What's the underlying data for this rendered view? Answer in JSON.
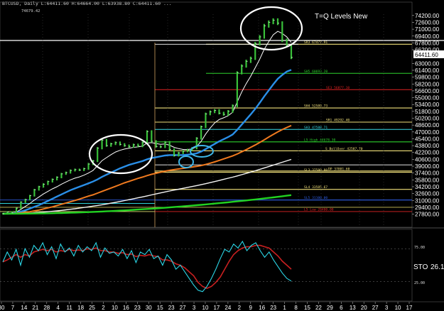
{
  "header": {
    "line": "BTCUSD, Daily  L:64411.60  H:64664.00  L:63938.80  C:64411.60  ...",
    "sub": "74679.42"
  },
  "title_overlay": "T=Q Levels New",
  "last_price": "64411.60",
  "colors": {
    "price": "#39c13a",
    "price_high": "#ffffff",
    "ema_fast": "#ffffff",
    "ema_mid": "#2a8fe8",
    "ema_slow": "#f07a1f",
    "ema_200": "#f5f5f5",
    "ema_long": "#22d322",
    "level_yellow": "#f1e07a",
    "level_green": "#2dd12d",
    "level_red": "#e02323",
    "level_cyan": "#39d9e6",
    "level_blue": "#2f5fe6",
    "stoch_k": "#2bd6e6",
    "stoch_d": "#c82020",
    "annot": "#ffffff",
    "annot_small": "#3fb7e8"
  },
  "chart_data": {
    "type": "line",
    "price_axis": {
      "ticks": [
        "74200.00",
        "72600.00",
        "71000.00",
        "69400.00",
        "67800.00",
        "66200.00",
        "64411.60",
        "63000.00",
        "61400.00",
        "59800.00",
        "58200.00",
        "56600.00",
        "55000.00",
        "53400.00",
        "51800.00",
        "50200.00",
        "48600.00",
        "47000.00",
        "45400.00",
        "43800.00",
        "42200.00",
        "40600.00",
        "39000.00",
        "37400.00",
        "35800.00",
        "34200.00",
        "32600.00",
        "31000.00",
        "29400.00",
        "27800.00"
      ],
      "ylim": [
        26400,
        75000
      ]
    },
    "date_axis": [
      "30",
      "7",
      "14",
      "21",
      "28",
      "4",
      "11",
      "18",
      "25",
      "2",
      "10",
      "16",
      "23",
      "30",
      "15",
      "23",
      "27",
      "3",
      "10",
      "17",
      "24",
      "2",
      "9",
      "16",
      "23",
      "1",
      "8",
      "15",
      "22",
      "29",
      "6",
      "13",
      "20",
      "27",
      "3",
      "10",
      "17"
    ],
    "levels": [
      {
        "label": "SR3 67477.91",
        "value": 67478,
        "color": "yellow"
      },
      {
        "label": "SH5 60693.20",
        "value": 60693,
        "color": "green"
      },
      {
        "label": "SE3 56877.10",
        "value": 56877,
        "color": "red"
      },
      {
        "label": "SH4 52589.73",
        "value": 52590,
        "color": "yellow"
      },
      {
        "label": "SR1 49292.40",
        "value": 49292,
        "color": "yellow"
      },
      {
        "label": "SH3 47588.71",
        "value": 47589,
        "color": "cyan"
      },
      {
        "label": "L5 High 44678.30",
        "value": 44678,
        "color": "green"
      },
      {
        "label": "S BollOver 42587.70",
        "value": 42588,
        "color": "yellow"
      },
      {
        "label": "SL3 37580.80",
        "value": 37581,
        "color": "yellow"
      },
      {
        "label": "DP 37881.60",
        "value": 37882,
        "color": "yellow"
      },
      {
        "label": "SL4 33585.67",
        "value": 33586,
        "color": "yellow"
      },
      {
        "label": "SL5 31100.00",
        "value": 31100,
        "color": "blue"
      },
      {
        "label": "L5 Low 28400.00",
        "value": 28400,
        "color": "red"
      }
    ],
    "series": [
      {
        "values": [
          27900,
          28300,
          28100,
          29200,
          30600,
          31200,
          32100,
          33500,
          34200,
          34800,
          35400,
          35900,
          36400,
          37200,
          37500,
          38000,
          38200,
          38100,
          38400,
          39500,
          40200,
          43200,
          45100,
          43800,
          44200,
          44500,
          44100,
          43800,
          43600,
          44000,
          43700,
          44500,
          47100,
          44800,
          43600,
          43500,
          44600,
          42900,
          41500,
          42100,
          42500,
          42800,
          43200,
          45500,
          48200,
          51200,
          51700,
          52000,
          51400,
          51100,
          51800,
          53100,
          60800,
          62400,
          63500,
          64200,
          67600,
          69200,
          71800,
          72600,
          73100,
          72400,
          68400,
          67200,
          64400
        ]
      },
      {
        "values": [
          27900,
          28000,
          28000,
          28300,
          28900,
          29600,
          30300,
          31100,
          31800,
          32500,
          33100,
          33700,
          34200,
          34800,
          35300,
          35800,
          36200,
          36500,
          36900,
          37400,
          38000,
          39100,
          40300,
          41000,
          41700,
          42300,
          42700,
          43000,
          43200,
          43400,
          43500,
          43700,
          44400,
          44500,
          44300,
          44100,
          44200,
          43900,
          43400,
          43100,
          42900,
          42900,
          43000,
          43600,
          44800,
          46500,
          47900,
          49100,
          49900,
          50300,
          50800,
          51600,
          54000,
          56300,
          58300,
          60000,
          62000,
          64000,
          66300,
          68100,
          69700,
          70500,
          70000,
          69200,
          67900
        ]
      },
      {
        "values": [
          27900,
          27950,
          28000,
          28150,
          28400,
          28700,
          29100,
          29500,
          29900,
          30400,
          30900,
          31400,
          31900,
          32400,
          32900,
          33400,
          33800,
          34200,
          34600,
          35000,
          35400,
          35900,
          36500,
          37000,
          37500,
          38000,
          38500,
          38900,
          39300,
          39600,
          39900,
          40200,
          40600,
          40900,
          41100,
          41300,
          41500,
          41600,
          41600,
          41600,
          41600,
          41700,
          41800,
          42000,
          42400,
          43000,
          43600,
          44200,
          44800,
          45300,
          45800,
          46400,
          47500,
          48700,
          49900,
          51100,
          52400,
          53800,
          55300,
          56700,
          58100,
          59400,
          60300,
          61100,
          61500
        ]
      },
      {
        "values": [
          27900,
          27920,
          27950,
          28000,
          28100,
          28200,
          28350,
          28550,
          28750,
          29000,
          29250,
          29500,
          29800,
          30100,
          30400,
          30700,
          31000,
          31300,
          31650,
          32000,
          32300,
          32700,
          33100,
          33500,
          33900,
          34300,
          34700,
          35100,
          35450,
          35800,
          36150,
          36450,
          36800,
          37100,
          37350,
          37600,
          37850,
          38050,
          38200,
          38350,
          38500,
          38650,
          38800,
          38950,
          39150,
          39400,
          39700,
          40000,
          40350,
          40700,
          41050,
          41400,
          41850,
          42350,
          42850,
          43400,
          43950,
          44550,
          45150,
          45800,
          46400,
          47000,
          47550,
          48050,
          48500
        ]
      },
      {
        "values": [
          27900,
          27905,
          27910,
          27930,
          27960,
          28000,
          28050,
          28110,
          28180,
          28260,
          28350,
          28450,
          28560,
          28680,
          28800,
          28930,
          29060,
          29200,
          29350,
          29500,
          29660,
          29820,
          29990,
          30170,
          30360,
          30550,
          30750,
          30960,
          31170,
          31390,
          31610,
          31830,
          32060,
          32290,
          32520,
          32750,
          32980,
          33200,
          33410,
          33620,
          33830,
          34040,
          34250,
          34460,
          34680,
          34910,
          35150,
          35400,
          35660,
          35920,
          36180,
          36440,
          36720,
          37010,
          37310,
          37610,
          37920,
          38240,
          38570,
          38900,
          39240,
          39580,
          39920,
          40250,
          40580
        ]
      },
      {
        "values": [
          27900,
          27900,
          27902,
          27905,
          27910,
          27918,
          27928,
          27940,
          27955,
          27972,
          27992,
          28014,
          28038,
          28065,
          28094,
          28126,
          28160,
          28196,
          28234,
          28275,
          28318,
          28363,
          28410,
          28460,
          28512,
          28566,
          28622,
          28680,
          28740,
          28802,
          28866,
          28932,
          29000,
          29070,
          29142,
          29216,
          29292,
          29370,
          29450,
          29532,
          29616,
          29702,
          29790,
          29880,
          29972,
          30066,
          30162,
          30260,
          30360,
          30462,
          30566,
          30672,
          30780,
          30890,
          31002,
          31116,
          31232,
          31350,
          31470,
          31592,
          31716,
          31842,
          31970,
          32100,
          32232
        ]
      }
    ],
    "stochastic": {
      "label": "STO",
      "value": "26.1",
      "ticks": [
        "75.00",
        "25.00"
      ],
      "k": [
        55,
        70,
        58,
        74,
        50,
        75,
        62,
        80,
        72,
        84,
        66,
        78,
        60,
        82,
        70,
        76,
        64,
        80,
        70,
        78,
        72,
        84,
        62,
        76,
        68,
        70,
        64,
        74,
        60,
        72,
        54,
        70,
        66,
        74,
        60,
        64,
        50,
        66,
        58,
        44,
        50,
        40,
        30,
        20,
        12,
        10,
        18,
        30,
        44,
        60,
        74,
        70,
        82,
        76,
        86,
        72,
        80,
        84,
        72,
        62,
        70,
        58,
        48,
        38,
        30,
        26
      ],
      "d": [
        55,
        58,
        62,
        66,
        62,
        66,
        64,
        70,
        72,
        74,
        72,
        74,
        70,
        72,
        71,
        74,
        72,
        73,
        72,
        75,
        74,
        76,
        72,
        72,
        70,
        70,
        68,
        69,
        66,
        67,
        63,
        65,
        64,
        66,
        64,
        63,
        58,
        58,
        56,
        52,
        50,
        46,
        40,
        34,
        24,
        18,
        15,
        18,
        24,
        32,
        44,
        56,
        66,
        72,
        76,
        78,
        78,
        80,
        80,
        78,
        76,
        70,
        64,
        56,
        50,
        44
      ]
    }
  },
  "annotations": [
    {
      "kind": "ellipse",
      "name": "consolidation-circle-1"
    },
    {
      "kind": "ellipse",
      "name": "dip-circle"
    },
    {
      "kind": "ellipse",
      "name": "base-circle"
    },
    {
      "kind": "ellipse",
      "name": "top-circle"
    }
  ]
}
